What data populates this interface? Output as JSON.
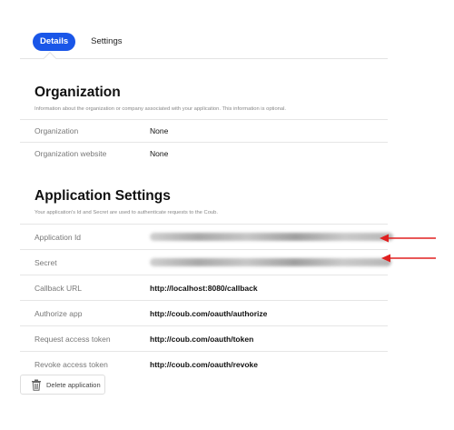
{
  "tabs": {
    "active": "Details",
    "other": "Settings"
  },
  "organization": {
    "title": "Organization",
    "description": "Information about the organization or company associated with your application. This information is optional.",
    "rows": [
      {
        "label": "Organization",
        "value": "None"
      },
      {
        "label": "Organization website",
        "value": "None"
      }
    ]
  },
  "app_settings": {
    "title": "Application Settings",
    "description": "Your application's Id and Secret are used to authenticate requests to the Coub.",
    "rows": [
      {
        "label": "Application Id"
      },
      {
        "label": "Secret"
      },
      {
        "label": "Callback URL",
        "value": "http://localhost:8080/callback"
      },
      {
        "label": "Authorize app",
        "value": "http://coub.com/oauth/authorize"
      },
      {
        "label": "Request access token",
        "value": "http://coub.com/oauth/token"
      },
      {
        "label": "Revoke access token",
        "value": "http://coub.com/oauth/revoke"
      }
    ]
  },
  "actions": {
    "delete_label": "Delete application"
  },
  "colors": {
    "accent": "#1a56e8",
    "arrow": "#e02020"
  },
  "icons": {
    "delete": "trash-icon",
    "annotation": "arrow-left-icon"
  }
}
